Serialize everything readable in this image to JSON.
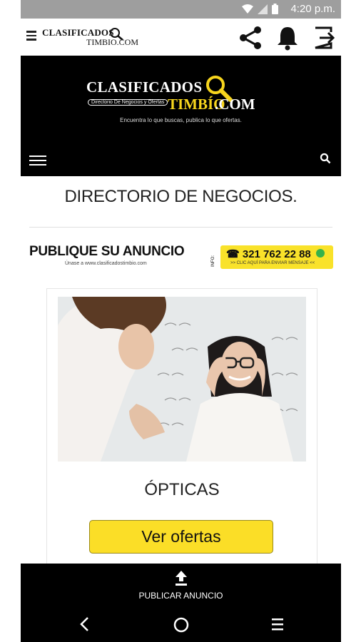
{
  "status_bar": {
    "time": "4:20 p.m.",
    "icons": [
      "wifi-icon",
      "signal-icon",
      "battery-icon"
    ]
  },
  "app_bar": {
    "logo_line1": "CLASIFICADOS",
    "logo_line2": "TIMBIO.COM",
    "actions": [
      "share-icon",
      "bell-icon",
      "logout-icon"
    ]
  },
  "banner": {
    "title_white": "CLASIFICADOS",
    "subtitle_badge": "Directorio De Negocios y Ofertas",
    "title_yellow": "TIMBÍO",
    "title_suffix": ".COM",
    "tagline": "Encuentra lo que buscas, publica lo que ofertas."
  },
  "page": {
    "title": "DIRECTORIO DE NEGOCIOS."
  },
  "ad": {
    "headline": "PUBLIQUE SU ANUNCIO",
    "subline": "Únase a www.clasificadostimbio.com",
    "info_label": "INFO:",
    "phone": "☎ 321 762 22 88",
    "cta": ">> CLIC AQUÍ PARA ENVIAR MENSAJE <<"
  },
  "category_card": {
    "title": "ÓPTICAS",
    "button_label": "Ver ofertas"
  },
  "bottom_action": {
    "label": "PUBLICAR ANUNCIO"
  },
  "colors": {
    "brand_yellow": "#f9e22a",
    "banner_black": "#000000",
    "status_gray": "#9e9e9e"
  }
}
